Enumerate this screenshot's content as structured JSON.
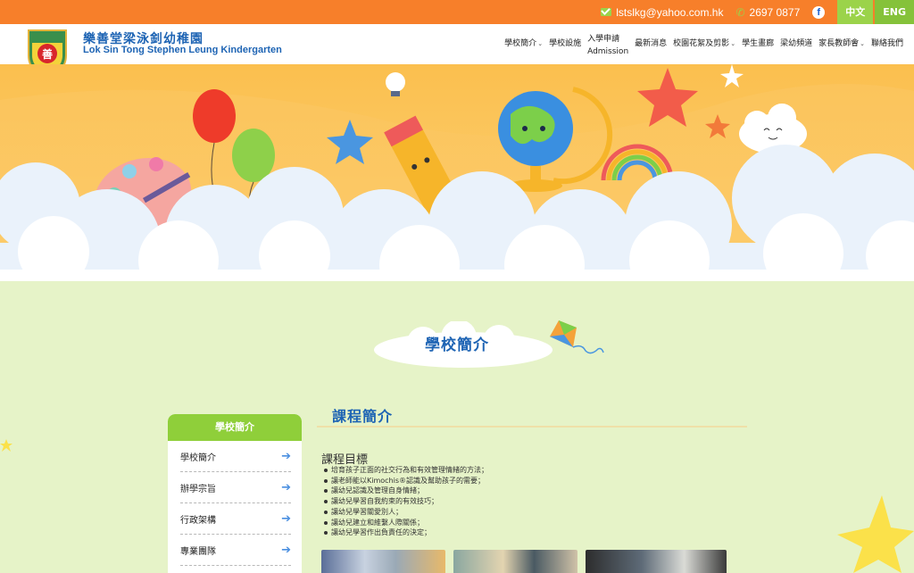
{
  "topbar": {
    "email": "lstslkg@yahoo.com.hk",
    "phone": "2697 0877",
    "facebook_glyph": "f",
    "lang_zh": "中文",
    "lang_en": "ENG"
  },
  "brand": {
    "name_zh": "樂善堂梁泳釗幼稚園",
    "name_en": "Lok Sin Tong Stephen Leung Kindergarten",
    "logo_glyph": "善"
  },
  "nav": {
    "items": [
      {
        "label": "學校簡介",
        "dropdown": true
      },
      {
        "label": "學校設施",
        "dropdown": false
      },
      {
        "label": "入學申請",
        "label2": "Admission",
        "dropdown": false
      },
      {
        "label": "最新消息",
        "dropdown": false
      },
      {
        "label": "校園花絮及剪影",
        "dropdown": true
      },
      {
        "label": "學生畫廊",
        "dropdown": false
      },
      {
        "label": "梁幼頻道",
        "dropdown": false
      },
      {
        "label": "家長教師會",
        "dropdown": true
      },
      {
        "label": "聯絡我們",
        "dropdown": false
      }
    ]
  },
  "page": {
    "section_title": "學校簡介"
  },
  "sidebar": {
    "title": "學校簡介",
    "items": [
      {
        "label": "學校簡介"
      },
      {
        "label": "辦學宗旨"
      },
      {
        "label": "行政架構"
      },
      {
        "label": "專業團隊"
      }
    ]
  },
  "main": {
    "title": "課程簡介",
    "subtitle": "課程目標",
    "goals": [
      "培育孩子正面的社交行為和有效管理情緒的方法；",
      "讓老師能以Kimochis®認識及幫助孩子的需要；",
      "讓幼兒認識及管理自身情緒；",
      "讓幼兒學習自我約束的有效技巧；",
      "讓幼兒學習關愛別人；",
      "讓幼兒建立和維繫人際關係；",
      "讓幼兒學習作出負責任的決定；"
    ]
  },
  "colors": {
    "topbar": "#f77f2a",
    "accent_green": "#8fcf3a",
    "brand_blue": "#1e64b4",
    "page_bg": "#e6f3c8"
  }
}
